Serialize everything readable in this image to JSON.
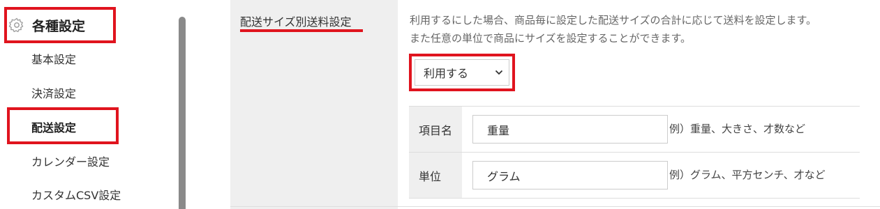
{
  "sidebar": {
    "title": "各種設定",
    "icon": "gear-icon",
    "items": [
      {
        "label": "基本設定"
      },
      {
        "label": "決済設定"
      },
      {
        "label": "配送設定"
      },
      {
        "label": "カレンダー設定"
      },
      {
        "label": "カスタムCSV設定"
      }
    ],
    "active_item": "配送設定"
  },
  "main": {
    "section_label": "配送サイズ別送料設定",
    "description": [
      "利用するにした場合、商品毎に設定した配送サイズの合計に応じて送料を設定します。",
      "また任意の単位で商品にサイズを設定することができます。"
    ],
    "select": {
      "value": "利用する",
      "icon": "chevron-down-icon"
    },
    "fields": [
      {
        "label": "項目名",
        "value": "重量",
        "hint": "例）重量、大きさ、才数など"
      },
      {
        "label": "単位",
        "value": "グラム",
        "hint": "例）グラム、平方センチ、才など"
      }
    ]
  },
  "colors": {
    "highlight": "#e0141e",
    "label_bg": "#efefef"
  }
}
